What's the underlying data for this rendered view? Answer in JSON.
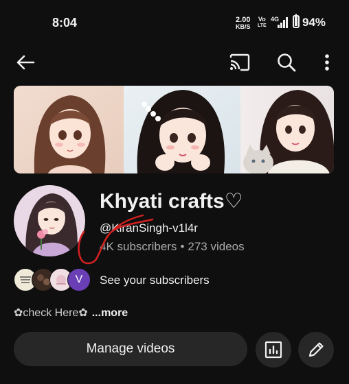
{
  "status_bar": {
    "time": "8:04",
    "net_speed_value": "2.00",
    "net_speed_unit": "KB/S",
    "volte_top": "Vo",
    "volte_bottom": "LTE",
    "network": "4G",
    "battery_percent": "94%",
    "battery_level": 0.94
  },
  "toolbar": {
    "back_icon": "arrow-left-icon",
    "cast_icon": "cast-icon",
    "search_icon": "search-icon",
    "more_icon": "more-vert-icon"
  },
  "channel": {
    "name": "Khyati crafts♡",
    "handle": "@KiranSingh-v1l4r",
    "subscribers": "4K subscribers",
    "separator": "•",
    "videos": "273 videos",
    "see_subscribers": "See your subscribers",
    "subscriber_badge_letter": "V",
    "description": "✿check Here✿",
    "more_label": "...more"
  },
  "actions": {
    "manage_videos": "Manage videos",
    "analytics_icon": "analytics-icon",
    "edit_icon": "pencil-icon"
  },
  "colors": {
    "background": "#0f0f0f",
    "button_bg": "#272727",
    "text_primary": "#f1f1f1",
    "text_secondary": "#aaaaaa",
    "annotation_red": "#d32020"
  }
}
